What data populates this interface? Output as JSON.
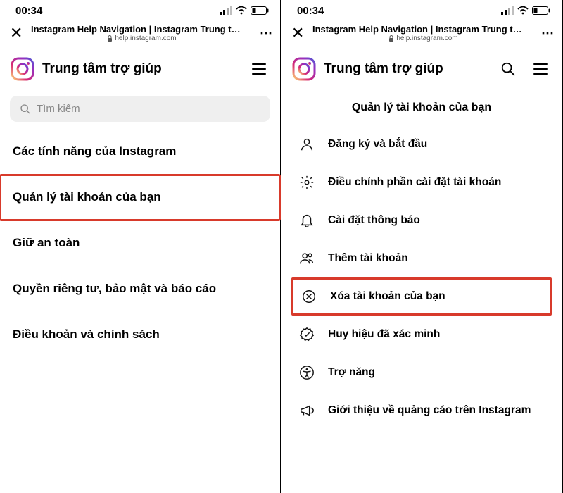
{
  "status": {
    "time": "00:34"
  },
  "browser": {
    "page_title": "Instagram Help Navigation | Instagram Trung t…",
    "url": "help.instagram.com"
  },
  "header": {
    "title": "Trung tâm trợ giúp"
  },
  "search": {
    "placeholder": "Tìm kiếm"
  },
  "left_categories": [
    {
      "label": "Các tính năng của Instagram",
      "highlighted": false
    },
    {
      "label": "Quản lý tài khoản của bạn",
      "highlighted": true
    },
    {
      "label": "Giữ an toàn",
      "highlighted": false
    },
    {
      "label": "Quyền riêng tư, bảo mật và báo cáo",
      "highlighted": false
    },
    {
      "label": "Điều khoản và chính sách",
      "highlighted": false
    }
  ],
  "right_section_title": "Quản lý tài khoản của bạn",
  "right_options": [
    {
      "icon": "user-icon",
      "label": "Đăng ký và bắt đầu",
      "highlighted": false
    },
    {
      "icon": "gear-icon",
      "label": "Điều chỉnh phần cài đặt tài khoản",
      "highlighted": false
    },
    {
      "icon": "bell-icon",
      "label": "Cài đặt thông báo",
      "highlighted": false
    },
    {
      "icon": "users-icon",
      "label": "Thêm tài khoản",
      "highlighted": false
    },
    {
      "icon": "delete-icon",
      "label": "Xóa tài khoản của bạn",
      "highlighted": true
    },
    {
      "icon": "badge-icon",
      "label": "Huy hiệu đã xác minh",
      "highlighted": false
    },
    {
      "icon": "accessibility-icon",
      "label": "Trợ năng",
      "highlighted": false
    },
    {
      "icon": "megaphone-icon",
      "label": "Giới thiệu về quảng cáo trên Instagram",
      "highlighted": false
    }
  ]
}
